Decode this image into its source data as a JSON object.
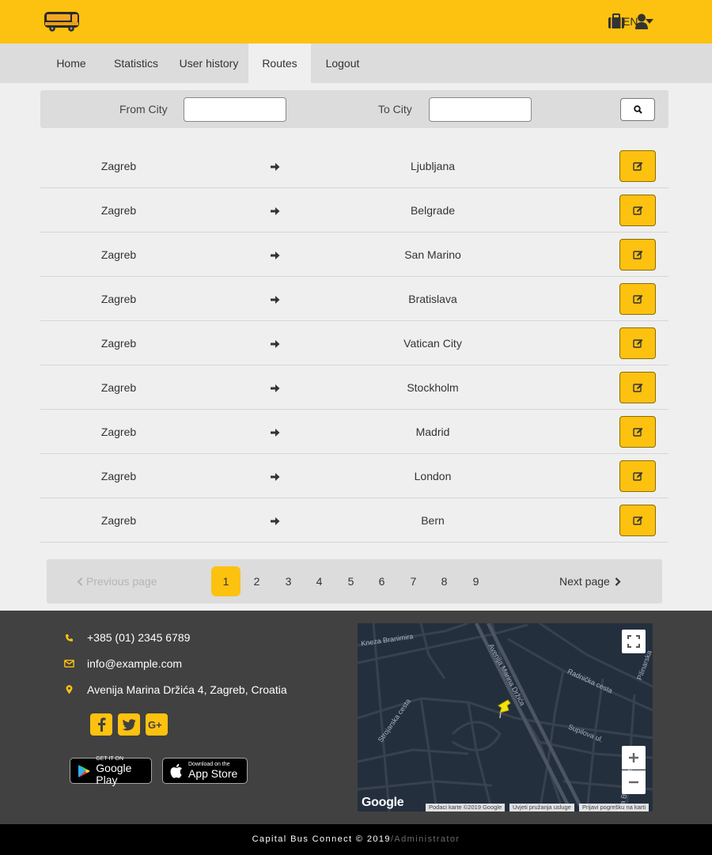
{
  "header": {
    "language": "EN",
    "brand_color": "#fdc10f"
  },
  "nav": {
    "items": [
      {
        "label": "Home",
        "active": false
      },
      {
        "label": "Statistics",
        "active": false
      },
      {
        "label": "User history",
        "active": false
      },
      {
        "label": "Routes",
        "active": true
      },
      {
        "label": "Logout",
        "active": false
      }
    ]
  },
  "search": {
    "from_label": "From City",
    "from_value": "",
    "to_label": "To City",
    "to_value": "",
    "button_icon": "search-icon"
  },
  "routes": [
    {
      "from": "Zagreb",
      "to": "Ljubljana"
    },
    {
      "from": "Zagreb",
      "to": "Belgrade"
    },
    {
      "from": "Zagreb",
      "to": "San Marino"
    },
    {
      "from": "Zagreb",
      "to": "Bratislava"
    },
    {
      "from": "Zagreb",
      "to": "Vatican City"
    },
    {
      "from": "Zagreb",
      "to": "Stockholm"
    },
    {
      "from": "Zagreb",
      "to": "Madrid"
    },
    {
      "from": "Zagreb",
      "to": "London"
    },
    {
      "from": "Zagreb",
      "to": "Bern"
    }
  ],
  "pagination": {
    "prev_label": "Previous page",
    "next_label": "Next page",
    "pages": [
      "1",
      "2",
      "3",
      "4",
      "5",
      "6",
      "7",
      "8",
      "9"
    ],
    "current": "1"
  },
  "footer": {
    "phone": "+385 (01) 2345 6789",
    "email": "info@example.com",
    "address": "Avenija Marina Držića 4, Zagreb, Croatia",
    "social": [
      "facebook-icon",
      "twitter-icon",
      "google-plus-icon"
    ],
    "google_play": {
      "small": "GET IT ON",
      "big": "Google Play"
    },
    "app_store": {
      "small": "Download on the",
      "big": "App Store"
    },
    "map": {
      "streets": {
        "kneza": "Kneza Branimira",
        "avenija": "Avenija Marina Držića",
        "radnicka": "Radnička cesta",
        "strojarska": "Strojarska cesta",
        "supilova": "Supilova ul.",
        "pilinarska": "Pilinarska",
        "buniceva": "Ulica Bunića Vučića"
      },
      "logo": "Google",
      "terms": [
        "Podaci karte ©2019 Google",
        "Uvjeti pružanja usluge",
        "Prijavi pogrešku na karti"
      ]
    },
    "copyright": "Capital Bus Connect © 2019",
    "role": "Administrator"
  }
}
